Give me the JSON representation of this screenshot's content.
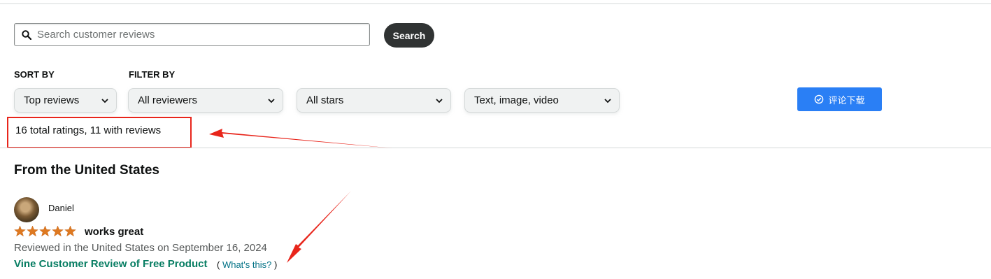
{
  "search": {
    "placeholder": "Search customer reviews",
    "button_label": "Search"
  },
  "filters": {
    "sort_label": "SORT BY",
    "filter_label": "FILTER BY",
    "sort_value": "Top reviews",
    "reviewers_value": "All reviewers",
    "stars_value": "All stars",
    "media_value": "Text, image, video"
  },
  "download_button": {
    "label": "评论下载",
    "icon": "check-circle-icon",
    "color": "#2a7ff5"
  },
  "ratings_summary": "16 total ratings, 11 with reviews",
  "section_title": "From the United States",
  "review": {
    "author": "Daniel",
    "rating": 5,
    "rating_max": 5,
    "title": "works great",
    "meta": "Reviewed in the United States on September 16, 2024",
    "vine_label": "Vine Customer Review of Free Product",
    "whats_this_open": "( ",
    "whats_this": "What's this?",
    "whats_this_close": " )"
  },
  "colors": {
    "annotation_red": "#e8251b",
    "star_orange": "#de7921",
    "vine_green": "#067d62",
    "link_teal": "#007185"
  }
}
